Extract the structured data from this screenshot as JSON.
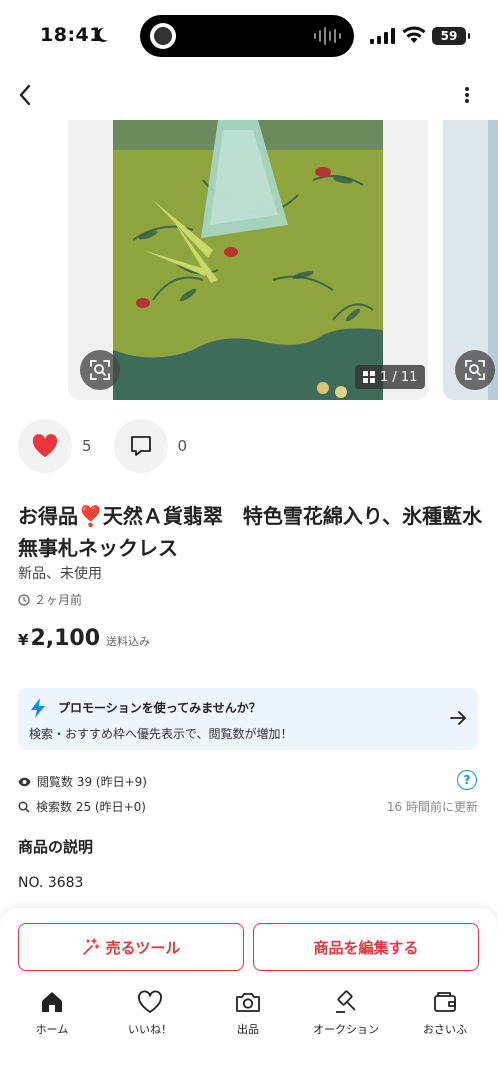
{
  "status_bar": {
    "time": "18:41",
    "battery": "59"
  },
  "carousel": {
    "counter": "1 / 11"
  },
  "engagement": {
    "likes": "5",
    "comments": "0"
  },
  "item": {
    "title": "お得品❣️天然Ａ貨翡翠　特色雪花綿入り、氷種藍水無事札ネックレス",
    "condition": "新品、未使用",
    "posted": "２ヶ月前",
    "currency": "¥",
    "price": "2,100",
    "shipping": "送料込み"
  },
  "promo": {
    "title": "プロモーションを使ってみませんか？",
    "subtitle": "検索・おすすめ枠へ優先表示で、閲覧数が増加！"
  },
  "stats": {
    "views": "閲覧数  39 (昨日+9)",
    "searches": "検索数  25 (昨日+0)",
    "updated": "16 時間前に更新"
  },
  "description": {
    "heading": "商品の説明",
    "text": "NO. 3683"
  },
  "actions": {
    "sell_tools": "売るツール",
    "edit_item": "商品を編集する"
  },
  "tabs": [
    {
      "label": "ホーム",
      "icon": "home-icon"
    },
    {
      "label": "いいね！",
      "icon": "heart-icon"
    },
    {
      "label": "出品",
      "icon": "camera-icon"
    },
    {
      "label": "オークション",
      "icon": "gavel-icon"
    },
    {
      "label": "おさいふ",
      "icon": "wallet-icon"
    }
  ],
  "colors": {
    "accent_red": "#e0383e",
    "like_red": "#e8363c",
    "promo_bg": "#eef6fd",
    "link_blue": "#1a8fd8"
  }
}
